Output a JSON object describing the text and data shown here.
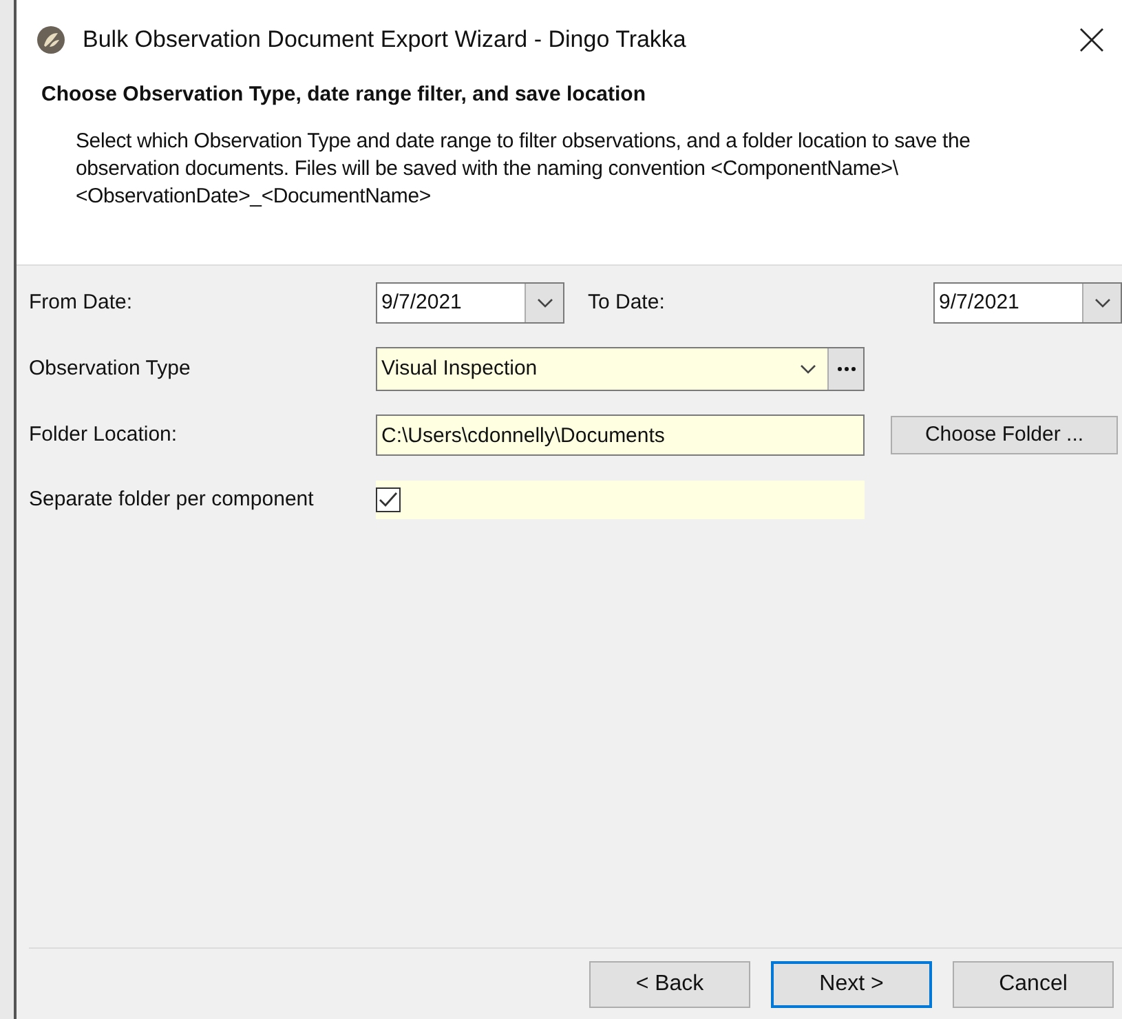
{
  "window": {
    "title": "Bulk Observation Document Export Wizard - Dingo Trakka"
  },
  "header": {
    "heading": "Choose Observation Type, date range filter, and save location",
    "description": "Select which Observation Type and date range to filter observations, and a folder location to save the observation documents. Files will be saved with the naming convention <ComponentName>\\<ObservationDate>_<DocumentName>"
  },
  "from_date": {
    "label": "From Date:",
    "value": "9/7/2021"
  },
  "to_date": {
    "label": "To Date:",
    "value": "9/7/2021"
  },
  "observation_type": {
    "label": "Observation Type",
    "value": "Visual Inspection"
  },
  "folder_location": {
    "label": "Folder Location:",
    "value": "C:\\Users\\cdonnelly\\Documents",
    "button": "Choose Folder ..."
  },
  "separate_folder": {
    "label": "Separate folder per component",
    "checked": true
  },
  "buttons": [
    {
      "label": "< Back",
      "focused": false
    },
    {
      "label": "Next >",
      "focused": true
    },
    {
      "label": "Cancel",
      "focused": false
    }
  ]
}
